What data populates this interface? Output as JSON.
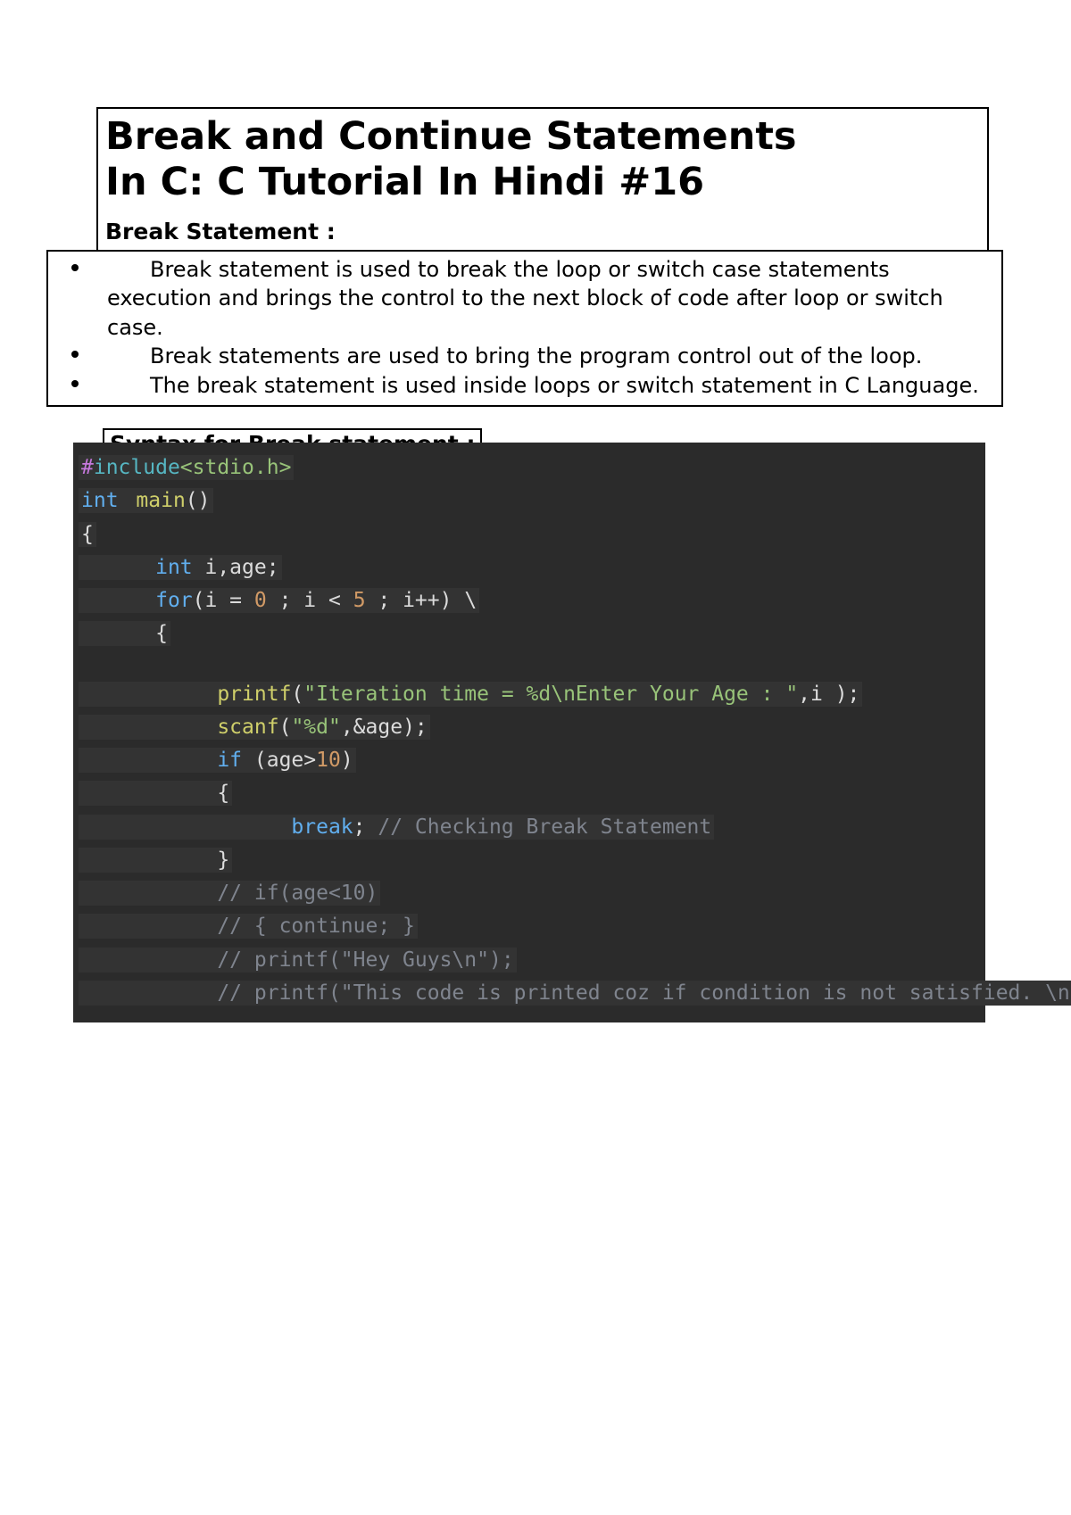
{
  "header": {
    "title_line1": "Break and Continue Statements",
    "title_line2": "In C: C Tutorial In Hindi #16",
    "subhead": "Break Statement :"
  },
  "bullets": [
    "Break statement is used to break the loop or switch case statements execution and brings the control to the next block of code after loop or switch case.",
    "Break statements are used to bring the program control out of the loop.",
    "The break statement is used inside loops or switch statement in C Language."
  ],
  "syntax_label": "Syntax for Break statement :",
  "code": {
    "l01_hash": "#",
    "l01_include": "include",
    "l01_hdr": "<stdio.h>",
    "l02_int": "int",
    "l02_sp": " ",
    "l02_main": "main",
    "l02_tail": "()",
    "l03": "{",
    "l04_pad": "      ",
    "l04_int": "int",
    "l04_tail": " i,age;",
    "l05_pad": "      ",
    "l05_for": "for",
    "l05_a": "(i = ",
    "l05_z0": "0",
    "l05_b": " ; i < ",
    "l05_z5": "5",
    "l05_c": " ; i++) \\",
    "l06_pad": "      ",
    "l06": "{",
    "l07_pad": "           ",
    "l07_printf": "printf",
    "l07_a": "(",
    "l07_str": "\"Iteration time = %d\\nEnter Your Age : \"",
    "l07_tail": ",i );",
    "l08_pad": "           ",
    "l08_scanf": "scanf",
    "l08_a": "(",
    "l08_str": "\"%d\"",
    "l08_tail": ",&age);",
    "l09_pad": "           ",
    "l09_if": "if",
    "l09_a": " (age>",
    "l09_ten": "10",
    "l09_b": ")",
    "l10_pad": "           ",
    "l10": "{",
    "l11_pad": "                 ",
    "l11_break": "break",
    "l11_sc": ";",
    "l11_sp": " ",
    "l11_cmt": "// Checking Break Statement",
    "l12_pad": "           ",
    "l12": "}",
    "l13_pad": "           ",
    "l13_cmt": "// if(age<10)",
    "l14_pad": "           ",
    "l14_cmt": "// { continue; }",
    "l15_pad": "           ",
    "l15_cmt": "// printf(\"Hey Guys\\n\");",
    "l16_pad": "           ",
    "l16_cmt": "// printf(\"This code is printed coz if condition is not satisfied. \\n\");"
  }
}
